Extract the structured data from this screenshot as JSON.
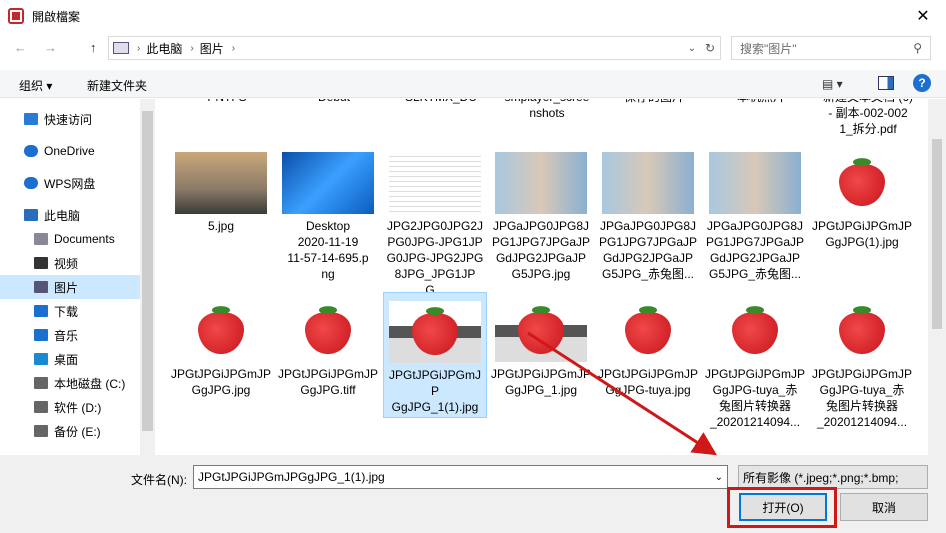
{
  "window": {
    "title": "開啟檔案",
    "close": "✕"
  },
  "address": {
    "back": "←",
    "forward": "→",
    "up": "↑",
    "crumbs": [
      "此电脑",
      "图片"
    ],
    "refresh": "↻",
    "search_placeholder": "搜索\"图片\""
  },
  "toolbar": {
    "organize": "组织 ▾",
    "new_folder": "新建文件夹",
    "view": "▤ ▾",
    "help": "?"
  },
  "sidebar": {
    "items": [
      {
        "label": "快速访问",
        "icon": "star-icon"
      },
      {
        "label": "OneDrive",
        "icon": "cloud-icon"
      },
      {
        "label": "WPS网盘",
        "icon": "cloud-icon"
      },
      {
        "label": "此电脑",
        "icon": "computer-icon"
      },
      {
        "label": "Documents",
        "icon": "document-icon"
      },
      {
        "label": "视频",
        "icon": "video-icon"
      },
      {
        "label": "图片",
        "icon": "picture-icon",
        "selected": true
      },
      {
        "label": "下载",
        "icon": "download-icon"
      },
      {
        "label": "音乐",
        "icon": "music-icon"
      },
      {
        "label": "桌面",
        "icon": "desktop-icon"
      },
      {
        "label": "本地磁盘 (C:)",
        "icon": "drive-icon"
      },
      {
        "label": "软件 (D:)",
        "icon": "drive-icon"
      },
      {
        "label": "备份 (E:)",
        "icon": "drive-icon"
      }
    ]
  },
  "files_top": [
    "PNTFS",
    "Debut",
    "SLKTMX_DU",
    "smplayer_scree\nnshots",
    "保存的图片",
    "本机照片",
    "新建文本文档 (6)\n- 副本-002-002\n1_拆分.pdf"
  ],
  "files_row1": [
    {
      "name": "5.jpg",
      "kind": "road"
    },
    {
      "name": "Desktop\n2020-11-19\n11-57-14-695.p\nng",
      "kind": "win"
    },
    {
      "name": "JPG2JPG0JPG2J\nPG0JPG-JPG1JP\nG0JPG-JPG2JPG\n8JPG_JPG1JPG...",
      "kind": "doc"
    },
    {
      "name": "JPGaJPG0JPG8J\nPG1JPG7JPGaJP\nGdJPG2JPGaJP\nG5JPG.jpg",
      "kind": "person"
    },
    {
      "name": "JPGaJPG0JPG8J\nPG1JPG7JPGaJP\nGdJPG2JPGaJP\nG5JPG_赤兔图...",
      "kind": "person"
    },
    {
      "name": "JPGaJPG0JPG8J\nPG1JPG7JPGaJP\nGdJPG2JPGaJP\nG5JPG_赤兔图...",
      "kind": "person"
    },
    {
      "name": "JPGtJPGiJPGmJP\nGgJPG(1).jpg",
      "kind": "straw"
    }
  ],
  "files_row2": [
    {
      "name": "JPGtJPGiJPGmJP\nGgJPG.jpg",
      "kind": "straw"
    },
    {
      "name": "JPGtJPGiJPGmJP\nGgJPG.tiff",
      "kind": "straw"
    },
    {
      "name": "JPGtJPGiJPGmJP\nGgJPG_1(1).jpg",
      "kind": "strawgray",
      "selected": true
    },
    {
      "name": "JPGtJPGiJPGmJP\nGgJPG_1.jpg",
      "kind": "strawgray"
    },
    {
      "name": "JPGtJPGiJPGmJP\nGgJPG-tuya.jpg",
      "kind": "straw"
    },
    {
      "name": "JPGtJPGiJPGmJP\nGgJPG-tuya_赤\n兔图片转换器\n_20201214094...",
      "kind": "straw"
    },
    {
      "name": "JPGtJPGiJPGmJP\nGgJPG-tuya_赤\n兔图片转换器\n_20201214094...",
      "kind": "straw"
    }
  ],
  "bottom": {
    "filename_label": "文件名(N):",
    "filename_value": "JPGtJPGiJPGmJPGgJPG_1(1).jpg",
    "filter": "所有影像 (*.jpeg;*.png;*.bmp;",
    "open": "打开(O)",
    "cancel": "取消"
  },
  "colors": {
    "selection": "#cce8ff",
    "accent": "#0078d7",
    "annotation": "#d01818"
  }
}
